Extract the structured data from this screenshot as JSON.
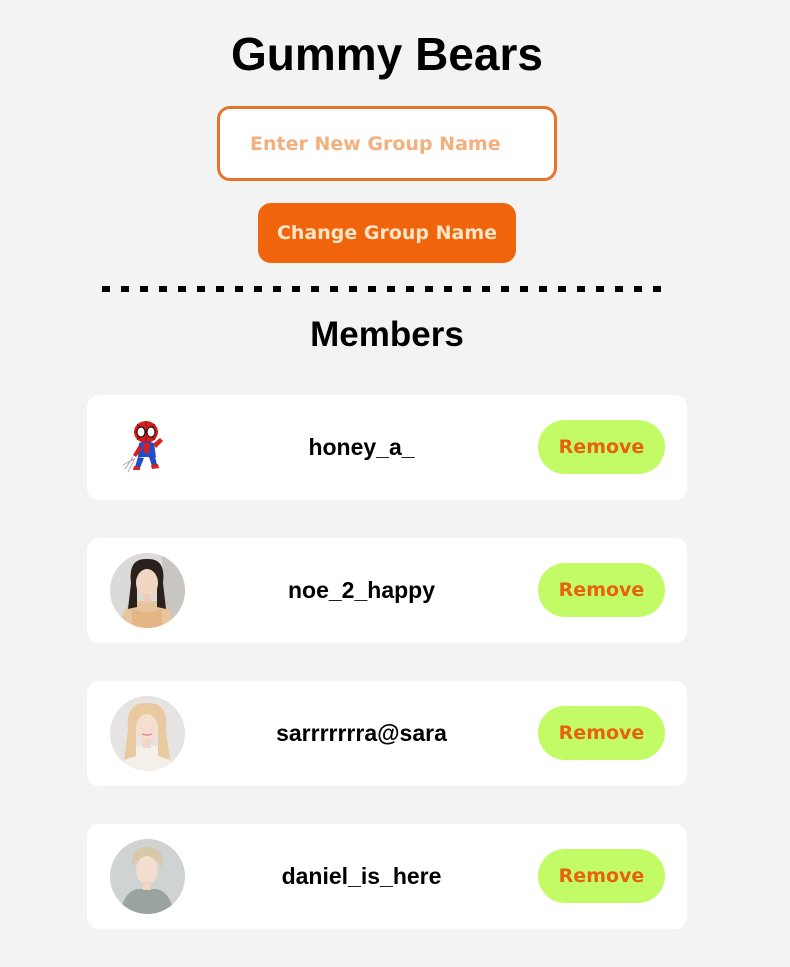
{
  "group": {
    "title": "Gummy Bears",
    "input_placeholder": "Enter New Group Name",
    "input_value": "",
    "change_button_label": "Change Group Name"
  },
  "members": {
    "heading": "Members",
    "remove_label": "Remove",
    "items": [
      {
        "username": "honey_a_",
        "avatar": "spiderman-sticker-icon"
      },
      {
        "username": "noe_2_happy",
        "avatar": "profile-photo"
      },
      {
        "username": "sarrrrrrra@sara",
        "avatar": "profile-photo"
      },
      {
        "username": "daniel_is_here",
        "avatar": "profile-photo"
      }
    ]
  },
  "colors": {
    "page_background": "#f3f3f3",
    "accent_orange": "#f0650b",
    "input_border": "#e8732c",
    "placeholder": "#f3b07e",
    "remove_button_bg": "#c2fb66",
    "remove_button_text": "#e8620d"
  }
}
